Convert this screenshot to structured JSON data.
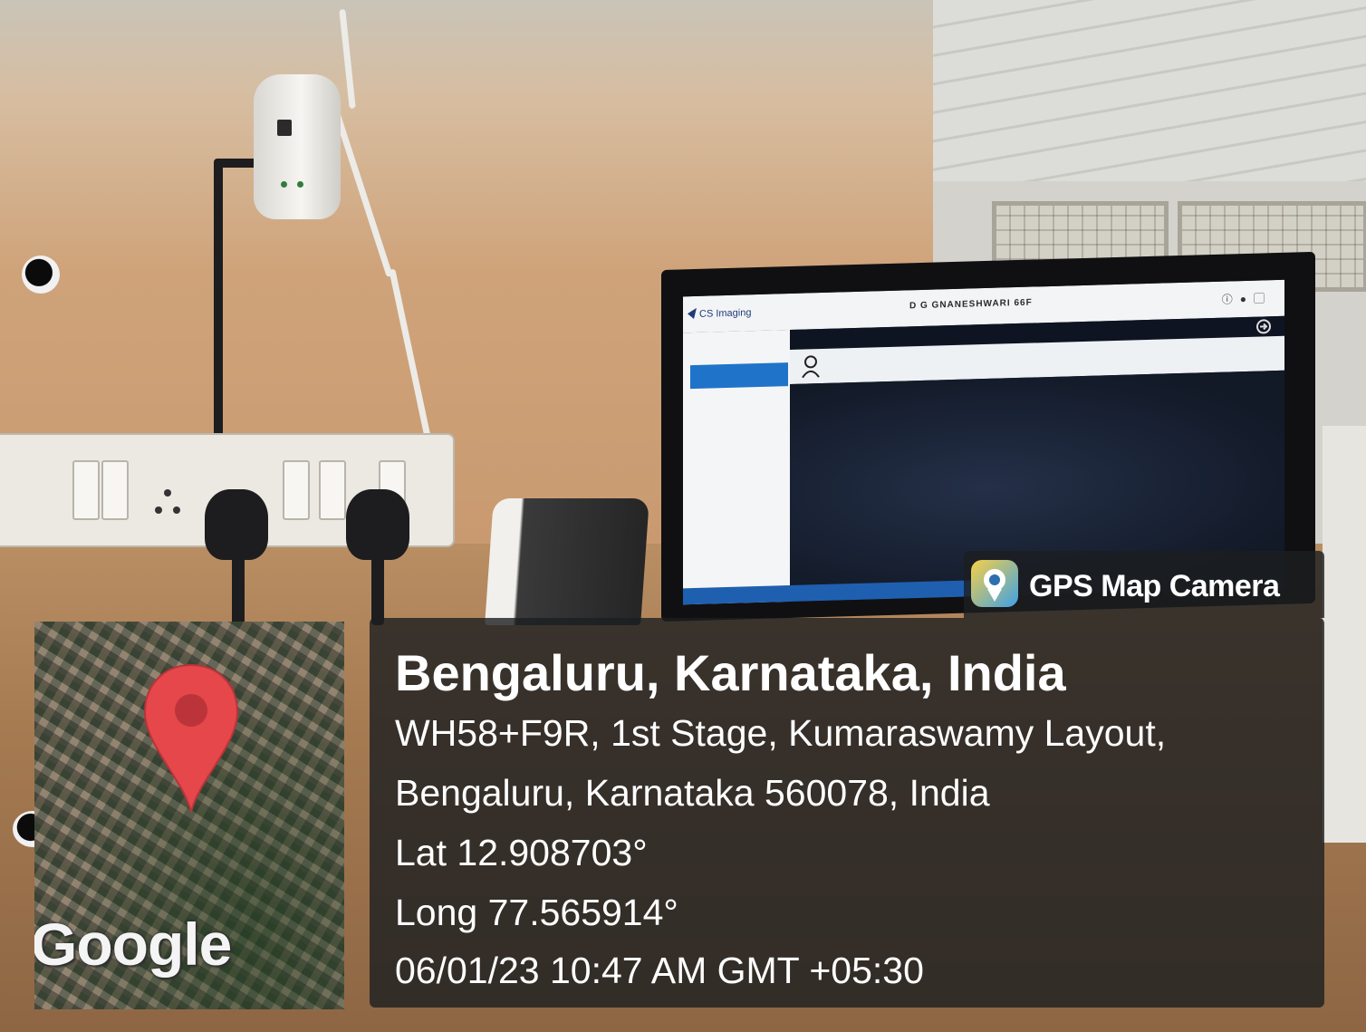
{
  "overlay": {
    "brand": "GPS Map Camera",
    "map_logo": "Google",
    "map_pin_icon": "map-pin-icon",
    "city_line": "Bengaluru, Karnataka, India",
    "address_line1": "WH58+F9R, 1st Stage, Kumaraswamy Layout,",
    "address_line2": "Bengaluru, Karnataka 560078, India",
    "latitude": "Lat 12.908703°",
    "longitude": "Long 77.565914°",
    "timestamp": "06/01/23 10:47 AM GMT +05:30"
  },
  "monitor_screen": {
    "app_name": "CS Imaging",
    "patient_title": "D G GNANESHWARI 66F"
  },
  "colors": {
    "panel_bg": "#1c1e20",
    "text": "#ffffff",
    "pin_red": "#e5474b",
    "screen_accent": "#1f74c9"
  }
}
